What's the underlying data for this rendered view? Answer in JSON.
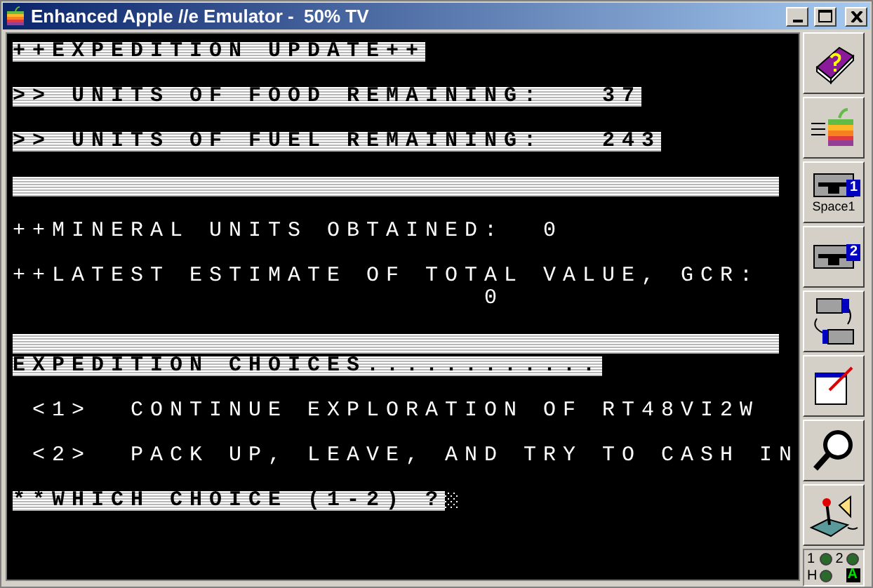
{
  "window": {
    "title": "Enhanced Apple //e Emulator -  50% TV"
  },
  "screen_lines": [
    {
      "kind": "inverse",
      "text": "++EXPEDITION UPDATE++"
    },
    {
      "kind": "blank"
    },
    {
      "kind": "inverse",
      "text": ">> UNITS OF FOOD REMAINING:   37"
    },
    {
      "kind": "blank"
    },
    {
      "kind": "inverse",
      "text": ">> UNITS OF FUEL REMAINING:   243"
    },
    {
      "kind": "blank"
    },
    {
      "kind": "bar"
    },
    {
      "kind": "blank"
    },
    {
      "kind": "normal",
      "text": "++MINERAL UNITS OBTAINED:  0"
    },
    {
      "kind": "blank"
    },
    {
      "kind": "normal",
      "text": "++LATEST ESTIMATE OF TOTAL VALUE, GCR:"
    },
    {
      "kind": "normal",
      "text": "                        0"
    },
    {
      "kind": "blank"
    },
    {
      "kind": "bar"
    },
    {
      "kind": "inverse",
      "text": "EXPEDITION CHOICES............"
    },
    {
      "kind": "blank"
    },
    {
      "kind": "normal",
      "text": " <1>  CONTINUE EXPLORATION OF RT48VI2W"
    },
    {
      "kind": "blank"
    },
    {
      "kind": "normal",
      "text": " <2>  PACK UP, LEAVE, AND TRY TO CASH IN"
    },
    {
      "kind": "blank"
    },
    {
      "kind": "prompt",
      "text": "**WHICH CHOICE (1-2) ?"
    }
  ],
  "toolbar": [
    {
      "kind": "help"
    },
    {
      "kind": "run"
    },
    {
      "kind": "drive",
      "badge": "1",
      "caption": "Space1"
    },
    {
      "kind": "drive",
      "badge": "2"
    },
    {
      "kind": "swap"
    },
    {
      "kind": "fullscreen"
    },
    {
      "kind": "debug"
    },
    {
      "kind": "settings"
    }
  ],
  "status": {
    "drive_1": "1",
    "drive_2": "2",
    "hard_disk": "H",
    "caps": "A"
  }
}
